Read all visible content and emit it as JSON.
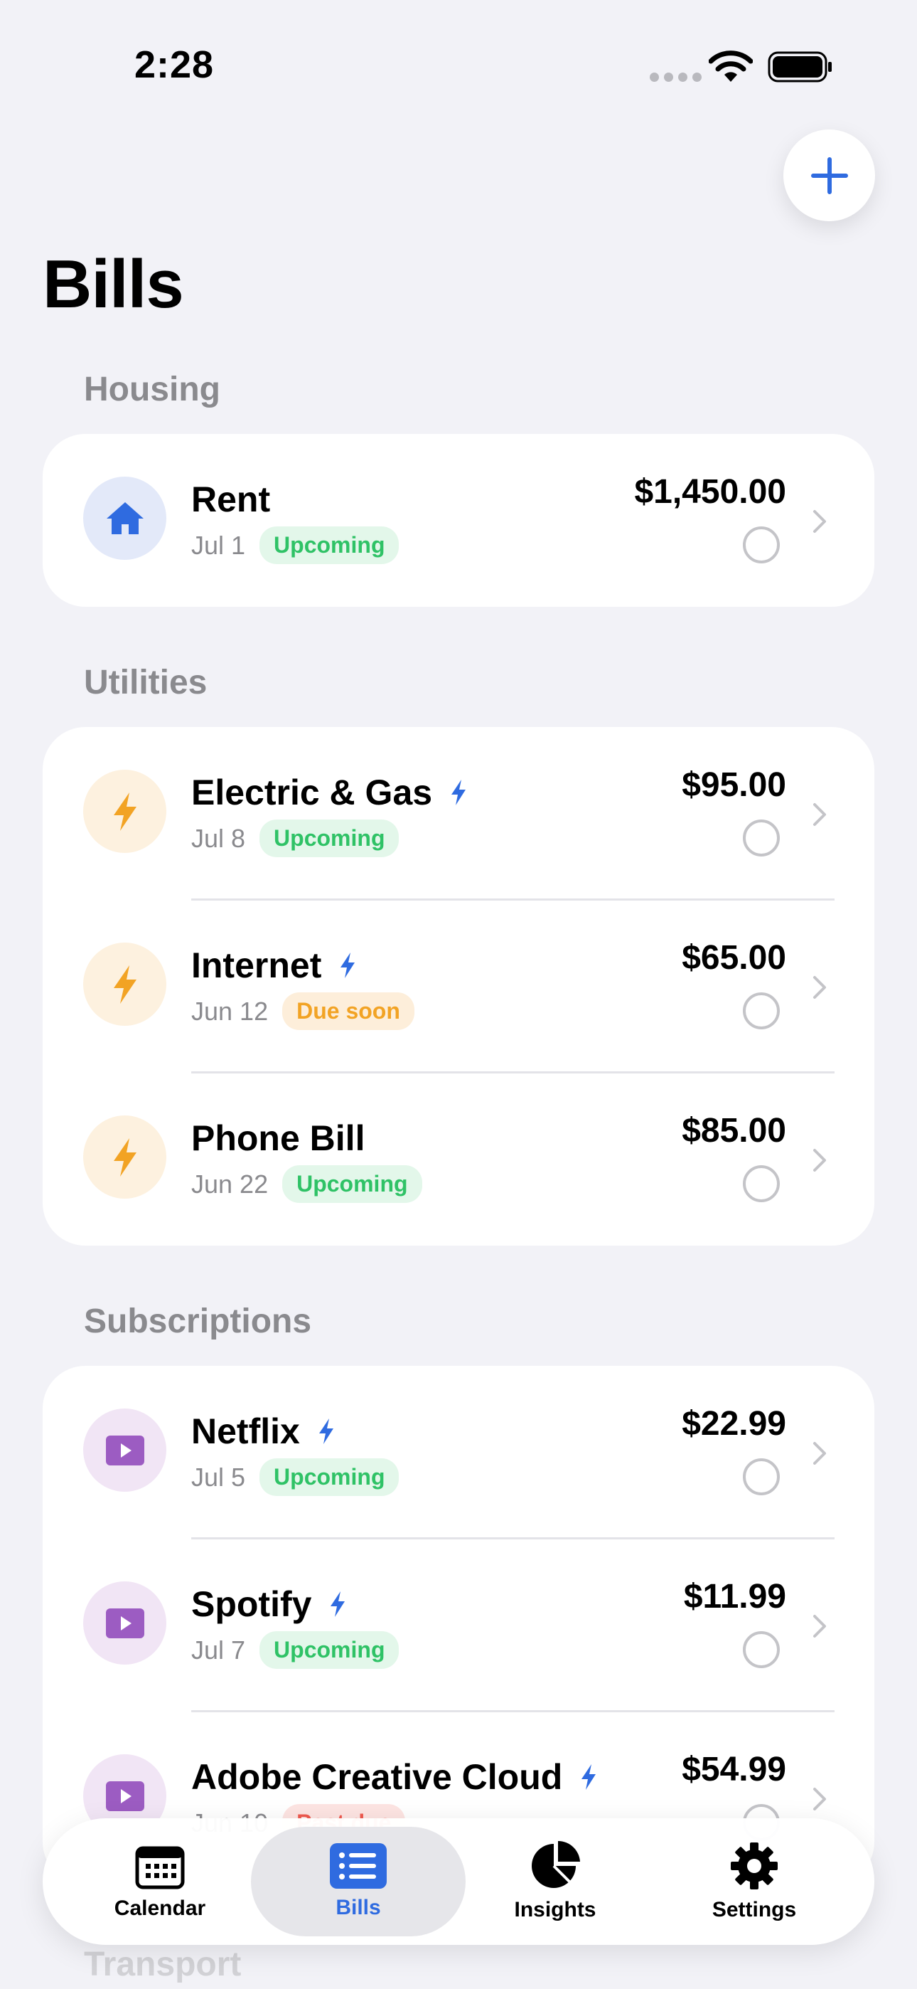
{
  "status_bar": {
    "time": "2:28"
  },
  "page": {
    "title": "Bills"
  },
  "colors": {
    "accent": "#2f6be0",
    "housing_icon_bg": "#e3e9f9",
    "utility_icon_bg": "#fdf1df",
    "utility_icon": "#f2a324",
    "subscription_icon_bg": "#f1e5f5",
    "subscription_icon": "#9c5cc2"
  },
  "sections": [
    {
      "title": "Housing",
      "icon": "house-icon",
      "bills": [
        {
          "name": "Rent",
          "date": "Jul 1",
          "status": "Upcoming",
          "amount": "$1,450.00",
          "autopay": false
        }
      ]
    },
    {
      "title": "Utilities",
      "icon": "bolt-icon",
      "bills": [
        {
          "name": "Electric & Gas",
          "date": "Jul 8",
          "status": "Upcoming",
          "amount": "$95.00",
          "autopay": true
        },
        {
          "name": "Internet",
          "date": "Jun 12",
          "status": "Due soon",
          "amount": "$65.00",
          "autopay": true
        },
        {
          "name": "Phone Bill",
          "date": "Jun 22",
          "status": "Upcoming",
          "amount": "$85.00",
          "autopay": false
        }
      ]
    },
    {
      "title": "Subscriptions",
      "icon": "play-icon",
      "bills": [
        {
          "name": "Netflix",
          "date": "Jul 5",
          "status": "Upcoming",
          "amount": "$22.99",
          "autopay": true
        },
        {
          "name": "Spotify",
          "date": "Jul 7",
          "status": "Upcoming",
          "amount": "$11.99",
          "autopay": true
        },
        {
          "name": "Adobe Creative Cloud",
          "date": "Jun 10",
          "status": "Past due",
          "amount": "$54.99",
          "autopay": true
        }
      ]
    },
    {
      "title": "Transport"
    }
  ],
  "tab_bar": {
    "active": "Bills",
    "tabs": [
      {
        "label": "Calendar",
        "icon": "calendar-icon"
      },
      {
        "label": "Bills",
        "icon": "list-icon"
      },
      {
        "label": "Insights",
        "icon": "pie-chart-icon"
      },
      {
        "label": "Settings",
        "icon": "gear-icon"
      }
    ]
  }
}
